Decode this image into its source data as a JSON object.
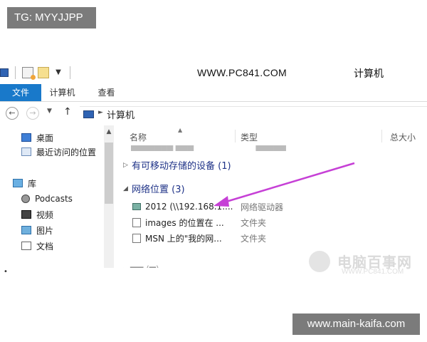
{
  "overlay_tag": "TG: MYYJJPP",
  "overlay_url": "www.main-kaifa.com",
  "titlebar": {
    "brand": "WWW.PC841.COM",
    "window_title": "计算机",
    "qat_icons": [
      "window-icon",
      "properties-icon",
      "new-folder-icon",
      "customize-dropdown-icon"
    ]
  },
  "ribbon": {
    "tabs": [
      "文件",
      "计算机",
      "查看"
    ],
    "active_tab": "文件",
    "accent": "#1979ca"
  },
  "address": {
    "path": "计算机"
  },
  "nav": {
    "items": [
      {
        "label": "桌面",
        "icon": "desktop-icon"
      },
      {
        "label": "最近访问的位置",
        "icon": "recent-places-icon"
      },
      {
        "label": "库",
        "icon": "library-icon"
      },
      {
        "label": "Podcasts",
        "icon": "podcast-icon"
      },
      {
        "label": "视频",
        "icon": "video-icon"
      },
      {
        "label": "图片",
        "icon": "picture-icon"
      },
      {
        "label": "文档",
        "icon": "document-icon"
      }
    ]
  },
  "columns": {
    "name": "名称",
    "type": "类型",
    "size": "总大小"
  },
  "groups": {
    "removable": "有可移动存储的设备 (1)",
    "network": "网络位置 (3)"
  },
  "network_items": [
    {
      "name": "2012 (\\\\192.168.1....",
      "type": "网络驱动器",
      "icon": "network-drive-icon"
    },
    {
      "name": "images 的位置在 ...",
      "type": "文件夹",
      "icon": "folder-icon"
    },
    {
      "name": "MSN 上的\"我的网...",
      "type": "文件夹",
      "icon": "folder-icon"
    }
  ],
  "annotation": {
    "color": "#c640d6"
  },
  "watermark": {
    "text": "电脑百事网",
    "url": "WWW.PC841.COM"
  }
}
